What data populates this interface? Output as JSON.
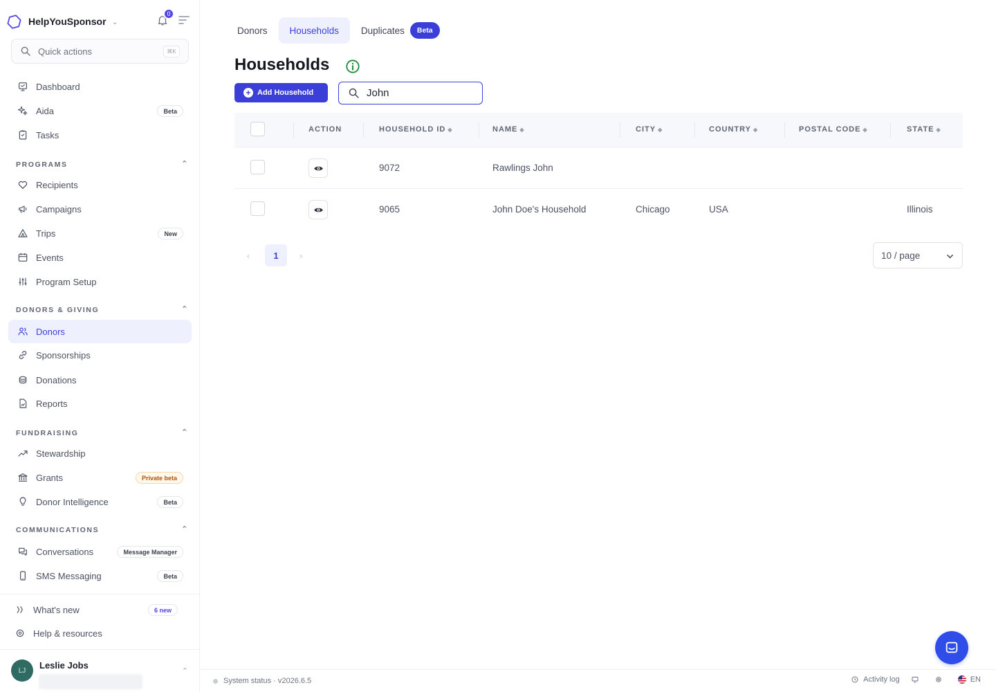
{
  "brand": {
    "name": "HelpYouSponsor",
    "notification_count": "0"
  },
  "quick_actions": {
    "placeholder": "Quick actions",
    "shortcut": "⌘K"
  },
  "sidebar": {
    "top_items": [
      {
        "label": "Dashboard"
      },
      {
        "label": "Aida",
        "badge": "Beta"
      },
      {
        "label": "Tasks"
      }
    ],
    "sections": [
      {
        "title": "PROGRAMS",
        "items": [
          {
            "label": "Recipients"
          },
          {
            "label": "Campaigns"
          },
          {
            "label": "Trips",
            "badge": "New"
          },
          {
            "label": "Events"
          },
          {
            "label": "Program Setup"
          }
        ]
      },
      {
        "title": "DONORS & GIVING",
        "items": [
          {
            "label": "Donors"
          },
          {
            "label": "Sponsorships"
          },
          {
            "label": "Donations"
          },
          {
            "label": "Reports"
          }
        ]
      },
      {
        "title": "FUNDRAISING",
        "items": [
          {
            "label": "Stewardship"
          },
          {
            "label": "Grants",
            "badge": "Private beta"
          },
          {
            "label": "Donor Intelligence",
            "badge": "Beta"
          }
        ]
      },
      {
        "title": "COMMUNICATIONS",
        "items": [
          {
            "label": "Conversations",
            "badge": "Message Manager"
          },
          {
            "label": "SMS Messaging",
            "badge": "Beta"
          }
        ]
      }
    ],
    "bottom_items": [
      {
        "label": "What's new",
        "badge": "6 new"
      },
      {
        "label": "Help & resources"
      }
    ],
    "user": {
      "initials": "LJ",
      "name": "Leslie Jobs"
    }
  },
  "tabs": [
    {
      "label": "Donors"
    },
    {
      "label": "Households"
    },
    {
      "label": "Duplicates",
      "badge": "Beta"
    }
  ],
  "page": {
    "title": "Households",
    "add_button": "Add Household"
  },
  "search": {
    "value": "John"
  },
  "table": {
    "columns": [
      "ACTION",
      "HOUSEHOLD ID",
      "NAME",
      "CITY",
      "COUNTRY",
      "POSTAL CODE",
      "STATE"
    ],
    "rows": [
      {
        "id": "9072",
        "name": "Rawlings John",
        "city": "",
        "country": "",
        "postal": "",
        "state": ""
      },
      {
        "id": "9065",
        "name": "John Doe's Household",
        "city": "Chicago",
        "country": "USA",
        "postal": "",
        "state": "Illinois"
      }
    ]
  },
  "pagination": {
    "current": "1",
    "page_size": "10 / page"
  },
  "footer": {
    "status": "System status · v2026.6.5",
    "activity": "Activity log",
    "language": "EN"
  },
  "colors": {
    "accent": "#3b3fd8",
    "active_bg": "#eef0fd",
    "chat": "#2f4de9"
  }
}
